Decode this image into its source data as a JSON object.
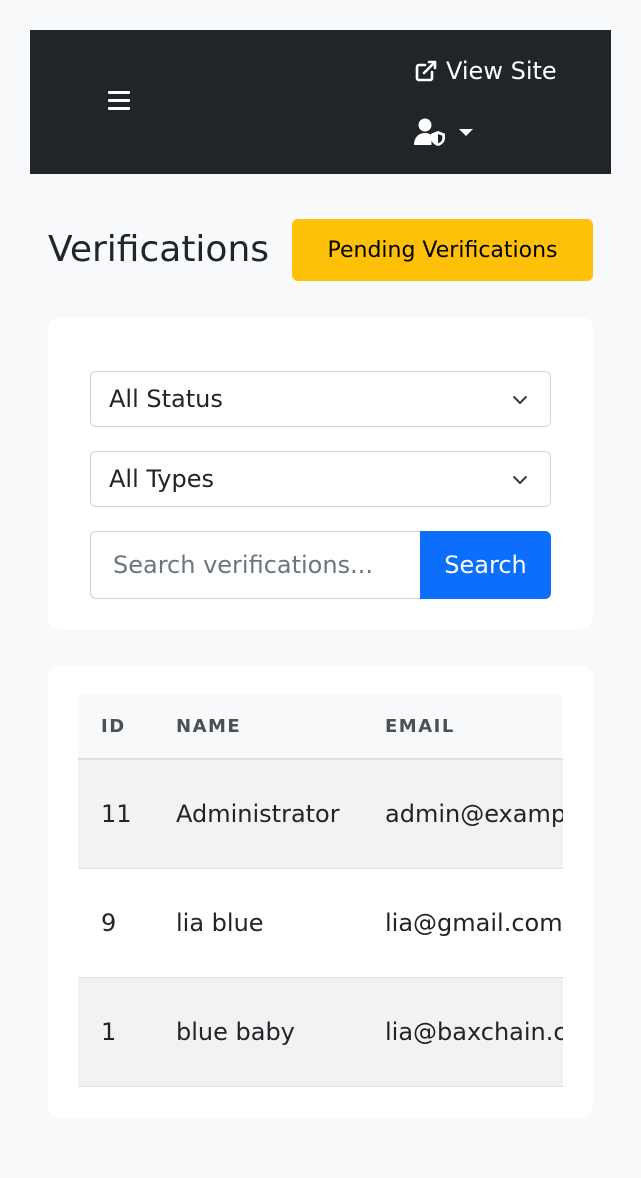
{
  "header": {
    "view_site_label": "View Site",
    "view_site_icon": "external-link-icon",
    "menu_icon": "hamburger-menu-icon",
    "user_icon": "user-shield-icon"
  },
  "page": {
    "title": "Verifications",
    "pending_button_label": "Pending Verifications",
    "pending_button_color": "#ffc107"
  },
  "filters": {
    "status_select": {
      "selected": "All Status"
    },
    "type_select": {
      "selected": "All Types"
    },
    "search": {
      "value": "",
      "placeholder": "Search verifications...",
      "button_label": "Search",
      "button_color": "#0d6efd"
    }
  },
  "table": {
    "columns": [
      "ID",
      "NAME",
      "EMAIL"
    ],
    "rows": [
      {
        "id": "11",
        "name": "Administrator",
        "email": "admin@example.com"
      },
      {
        "id": "9",
        "name": "lia blue",
        "email": "lia@gmail.com"
      },
      {
        "id": "1",
        "name": "blue baby",
        "email": "lia@baxchain.com"
      }
    ]
  }
}
